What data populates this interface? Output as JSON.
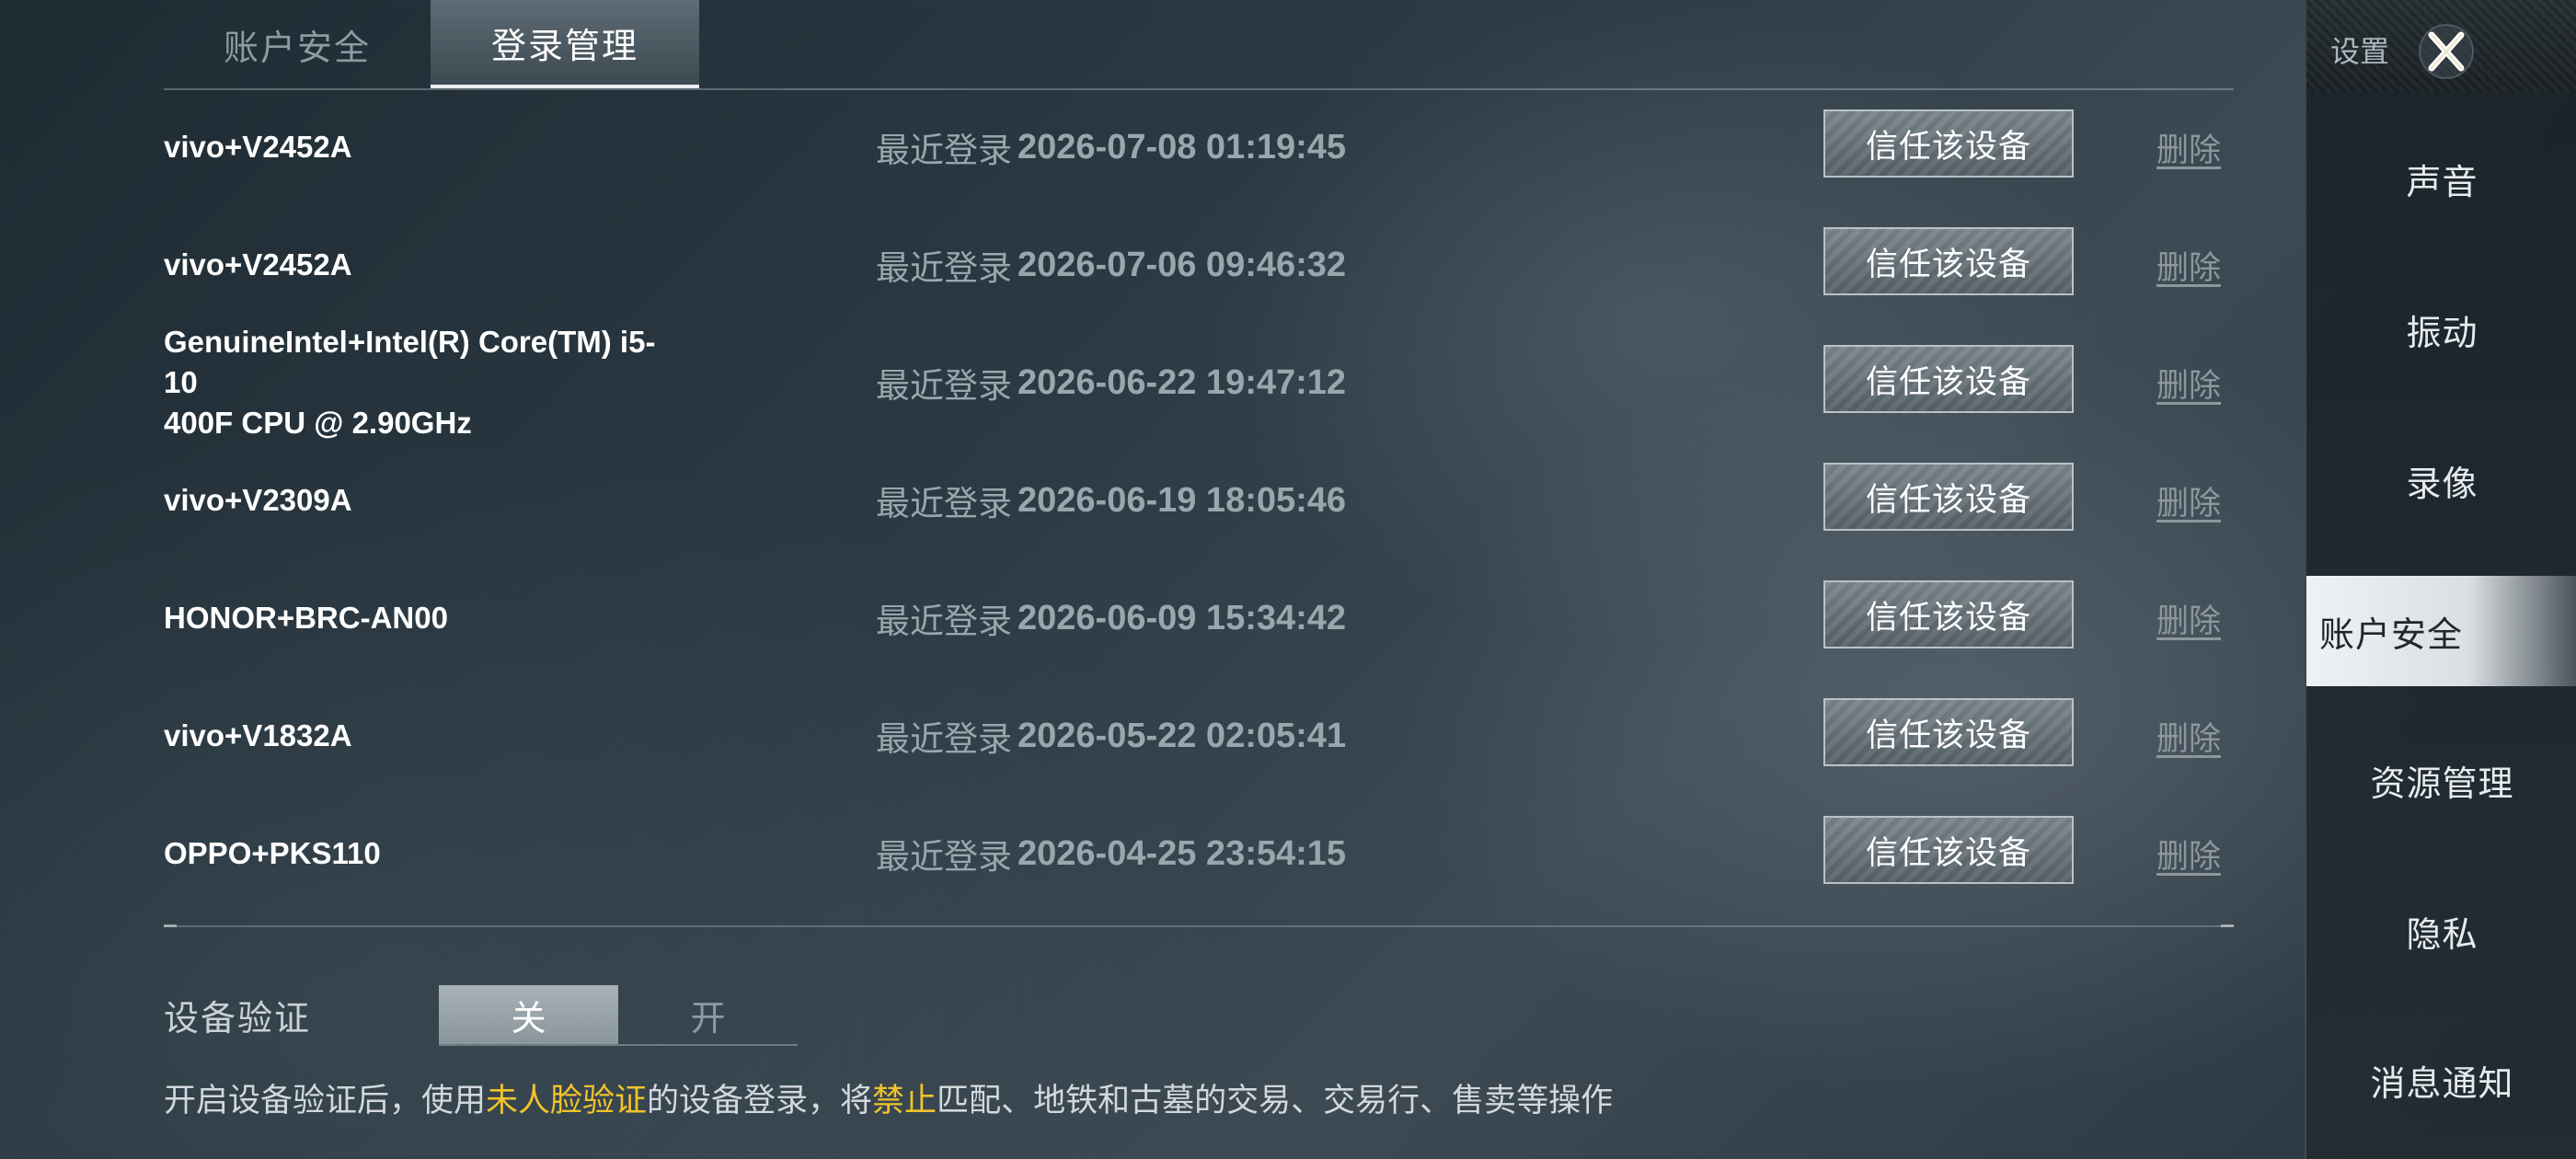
{
  "tabs": [
    {
      "label": "账户安全",
      "active": false
    },
    {
      "label": "登录管理",
      "active": true
    }
  ],
  "devices": [
    {
      "name": "vivo+V2452A",
      "last_login_label": "最近登录",
      "last_login": "2026-07-08 01:19:45",
      "trust_label": "信任该设备",
      "delete_label": "删除"
    },
    {
      "name": "vivo+V2452A",
      "last_login_label": "最近登录",
      "last_login": "2026-07-06 09:46:32",
      "trust_label": "信任该设备",
      "delete_label": "删除"
    },
    {
      "name": "GenuineIntel+Intel(R) Core(TM) i5-10\n400F CPU @ 2.90GHz",
      "last_login_label": "最近登录",
      "last_login": "2026-06-22 19:47:12",
      "trust_label": "信任该设备",
      "delete_label": "删除"
    },
    {
      "name": "vivo+V2309A",
      "last_login_label": "最近登录",
      "last_login": "2026-06-19 18:05:46",
      "trust_label": "信任该设备",
      "delete_label": "删除"
    },
    {
      "name": "HONOR+BRC-AN00",
      "last_login_label": "最近登录",
      "last_login": "2026-06-09 15:34:42",
      "trust_label": "信任该设备",
      "delete_label": "删除"
    },
    {
      "name": "vivo+V1832A",
      "last_login_label": "最近登录",
      "last_login": "2026-05-22 02:05:41",
      "trust_label": "信任该设备",
      "delete_label": "删除"
    },
    {
      "name": "OPPO+PKS110",
      "last_login_label": "最近登录",
      "last_login": "2026-04-25 23:54:15",
      "trust_label": "信任该设备",
      "delete_label": "删除"
    }
  ],
  "verification": {
    "label": "设备验证",
    "off_label": "关",
    "on_label": "开",
    "selected": "关"
  },
  "note": {
    "part1": "开启设备验证后，使用",
    "highlight1": "未人脸验证",
    "part2": "的设备登录，将",
    "highlight2": "禁止",
    "part3": "匹配、地铁和古墓的交易、交易行、售卖等操作"
  },
  "sidebar": {
    "title": "设置",
    "close_icon": "close-icon",
    "items": [
      {
        "label": "声音",
        "active": false
      },
      {
        "label": "振动",
        "active": false
      },
      {
        "label": "录像",
        "active": false
      },
      {
        "label": "账户安全",
        "active": true
      },
      {
        "label": "资源管理",
        "active": false
      },
      {
        "label": "隐私",
        "active": false
      },
      {
        "label": "消息通知",
        "active": false
      }
    ]
  },
  "colors": {
    "highlight": "#f0c429",
    "text_primary": "#ffffff",
    "text_muted": "#9aa6ad"
  }
}
